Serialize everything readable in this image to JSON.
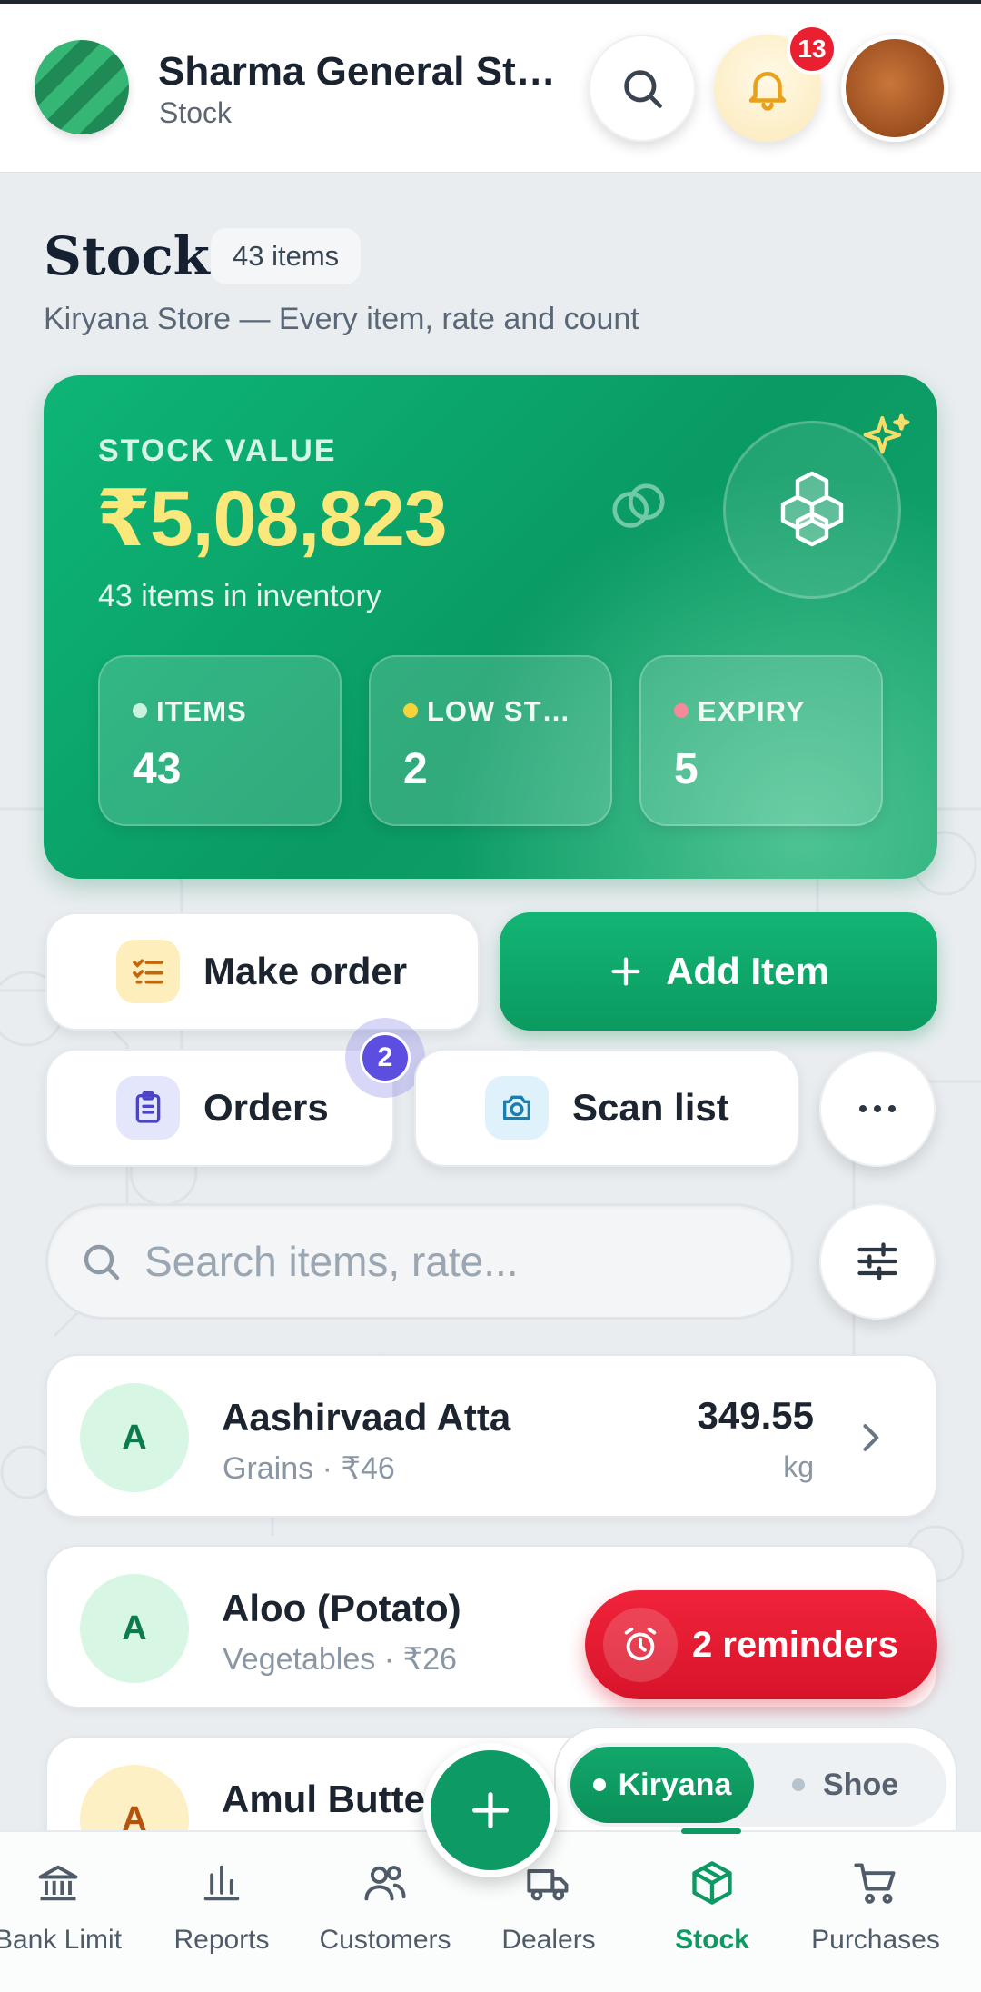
{
  "header": {
    "store_name": "Sharma General Store",
    "section": "Stock",
    "notification_count": "13"
  },
  "page": {
    "title": "Stock",
    "count_chip": "43 items",
    "description": "Kiryana Store — Every item, rate and count"
  },
  "stock_card": {
    "label": "STOCK VALUE",
    "value": "₹5,08,823",
    "subtitle": "43 items in inventory",
    "stats": [
      {
        "label": "ITEMS",
        "value": "43",
        "dot_color": "#c9f3dd"
      },
      {
        "label": "LOW ST…",
        "value": "2",
        "dot_color": "#f7d23a"
      },
      {
        "label": "EXPIRY",
        "value": "5",
        "dot_color": "#f58a9a"
      }
    ]
  },
  "actions": {
    "make_order": "Make order",
    "add_item": "Add Item",
    "orders": "Orders",
    "orders_badge": "2",
    "scan_list": "Scan list"
  },
  "search": {
    "placeholder": "Search items, rate..."
  },
  "items": [
    {
      "initial": "A",
      "name": "Aashirvaad Atta",
      "meta": "Grains · ₹46",
      "qty": "349.55",
      "unit": "kg"
    },
    {
      "initial": "A",
      "name": "Aloo (Potato)",
      "meta": "Vegetables · ₹26",
      "qty": "",
      "unit": ""
    },
    {
      "initial": "A",
      "name": "Amul Butte",
      "meta": "",
      "qty": "",
      "unit": ""
    }
  ],
  "reminders": {
    "label": "2 reminders"
  },
  "segment": {
    "active": "Kiryana",
    "inactive": "Shoe"
  },
  "nav": [
    {
      "label": "Bank Limit",
      "icon": "bank-icon"
    },
    {
      "label": "Reports",
      "icon": "bar-chart-icon"
    },
    {
      "label": "Customers",
      "icon": "users-icon"
    },
    {
      "label": "Dealers",
      "icon": "truck-icon"
    },
    {
      "label": "Stock",
      "icon": "box-icon"
    },
    {
      "label": "Purchases",
      "icon": "cart-icon"
    }
  ],
  "colors": {
    "accent": "#0e9a64",
    "value_yellow": "#fbe87a",
    "alert_red": "#ea2030",
    "orders_purple": "#5b4ee0"
  }
}
